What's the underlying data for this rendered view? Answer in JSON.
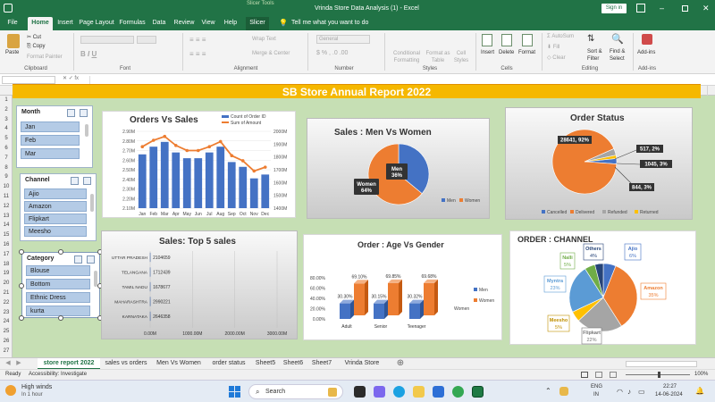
{
  "window": {
    "file_title": "Vrinda Store Data Analysis (1)  -  Excel",
    "tools_label": "Slicer Tools",
    "signin": "Sign in"
  },
  "ribbon_tabs": [
    "File",
    "Home",
    "Insert",
    "Page Layout",
    "Formulas",
    "Data",
    "Review",
    "View",
    "Help",
    "Slicer"
  ],
  "tell_me": "Tell me what you want to do",
  "ribbon": {
    "paste": "Paste",
    "cut": "Cut",
    "copy": "Copy",
    "format_painter": "Format Painter",
    "wrap_text": "Wrap Text",
    "merge_center": "Merge & Center",
    "number_format": "General",
    "conditional": "Conditional Formatting",
    "format_table": "Format as Table",
    "cell_styles": "Cell Styles",
    "insert": "Insert",
    "delete": "Delete",
    "format": "Format",
    "autosum": "AutoSum",
    "fill": "Fill",
    "clear": "Clear",
    "sort_filter": "Sort & Filter",
    "find_select": "Find & Select",
    "addins": "Add-ins",
    "groups": [
      "Clipboard",
      "Font",
      "Alignment",
      "Number",
      "Styles",
      "Cells",
      "Editing",
      "Add-ins"
    ]
  },
  "columns": [
    "A",
    "B",
    "C",
    "D",
    "E",
    "F",
    "G",
    "H",
    "I",
    "J",
    "K",
    "L",
    "M",
    "N",
    "O",
    "P",
    "Q",
    "R",
    "S",
    "T",
    "U",
    "V",
    "W"
  ],
  "rows": [
    "1",
    "2",
    "3",
    "4",
    "5",
    "6",
    "7",
    "8",
    "9",
    "10",
    "11",
    "12",
    "13",
    "14",
    "15",
    "16",
    "17",
    "18",
    "19",
    "20",
    "21",
    "22",
    "23",
    "24",
    "25",
    "26",
    "27"
  ],
  "banner": "SB Store Annual Report 2022",
  "slicers": {
    "month": {
      "title": "Month",
      "items": [
        "Jan",
        "Feb",
        "Mar"
      ]
    },
    "channel": {
      "title": "Channel",
      "items": [
        "Ajio",
        "Amazon",
        "Flipkart",
        "Meesho"
      ]
    },
    "category": {
      "title": "Category",
      "items": [
        "Blouse",
        "Bottom",
        "Ethnic Dress",
        "kurta"
      ]
    }
  },
  "charts": {
    "orders_sales": {
      "title": "Orders Vs Sales",
      "legend_count": "Count of Order ID",
      "legend_sum": "Sum of Amount",
      "left_ticks": [
        "2.90M",
        "2.80M",
        "2.70M",
        "2.60M",
        "2.50M",
        "2.40M",
        "2.30M",
        "2.20M",
        "2.10M"
      ],
      "right_ticks": [
        "2000M",
        "1900M",
        "1800M",
        "1700M",
        "1600M",
        "1500M",
        "1400M"
      ],
      "months": [
        "Jan",
        "Feb",
        "Mar",
        "Apr",
        "May",
        "Jun",
        "Jul",
        "Aug",
        "Sep",
        "Oct",
        "Nov",
        "Dec"
      ]
    },
    "men_women": {
      "title": "Sales : Men Vs Women",
      "men_label": "Men",
      "men_pct": "36%",
      "women_label": "Women",
      "women_pct": "64%",
      "legend_men": "Men",
      "legend_women": "Women"
    },
    "order_status": {
      "title": "Order Status",
      "delivered": "28641, 92%",
      "returned": "517, 2%",
      "refunded": "1045, 3%",
      "cancelled": "844, 3%",
      "legend": [
        "Cancelled",
        "Delivered",
        "Refunded",
        "Returned"
      ]
    },
    "top5": {
      "title": "Sales: Top 5 sales",
      "axis": [
        "0.00M",
        "1000.00M",
        "2000.00M",
        "3000.00M"
      ]
    },
    "age_gender": {
      "title": "Order : Age Vs Gender",
      "y_ticks": [
        "80.00%",
        "60.00%",
        "40.00%",
        "20.00%",
        "0.00%"
      ],
      "labels": {
        "adult_men": "30.30%",
        "adult_women": "69.10%",
        "senior_men": "30.15%",
        "senior_women": "69.85%",
        "teen_men": "30.32%",
        "teen_women": "69.68%"
      },
      "groups": [
        "Adult",
        "Senior",
        "Teenager"
      ],
      "legend_men": "Men",
      "legend_women": "Women",
      "axis_women": "Women"
    },
    "channel": {
      "title": "ORDER : CHANNEL",
      "labels": {
        "ajio": "Ajio",
        "ajio_p": "6%",
        "amazon": "Amazon",
        "amazon_p": "35%",
        "flipkart": "Flipkart",
        "flipkart_p": "22%",
        "meesho": "Meesho",
        "meesho_p": "5%",
        "myntra": "Myntra",
        "myntra_p": "23%",
        "nalli": "Nalli",
        "nalli_p": "5%",
        "others": "Others",
        "others_p": "4%"
      }
    }
  },
  "chart_data": [
    {
      "type": "line",
      "title": "Orders Vs Sales",
      "x": [
        "Jan",
        "Feb",
        "Mar",
        "Apr",
        "May",
        "Jun",
        "Jul",
        "Aug",
        "Sep",
        "Oct",
        "Nov",
        "Dec"
      ],
      "series": [
        {
          "name": "Count of Order ID",
          "values": [
            2.66,
            2.74,
            2.79,
            2.68,
            2.62,
            2.62,
            2.68,
            2.74,
            2.58,
            2.53,
            2.41,
            2.45
          ]
        },
        {
          "name": "Sum of Amount",
          "values": [
            1880,
            1930,
            1960,
            1890,
            1850,
            1850,
            1880,
            1920,
            1810,
            1770,
            1690,
            1720
          ]
        }
      ],
      "ylim": [
        2.1,
        2.9
      ],
      "y2lim": [
        1400,
        2000
      ]
    },
    {
      "type": "pie",
      "title": "Sales : Men Vs Women",
      "categories": [
        "Men",
        "Women"
      ],
      "values": [
        36,
        64
      ]
    },
    {
      "type": "pie",
      "title": "Order Status",
      "categories": [
        "Cancelled",
        "Delivered",
        "Refunded",
        "Returned"
      ],
      "values": [
        844,
        28641,
        1045,
        517
      ]
    },
    {
      "type": "bar",
      "title": "Sales: Top 5 sales",
      "categories": [
        "UTTAR PRADESH",
        "TELANGANA",
        "TAMIL NADU",
        "MAHARASHTRA",
        "KARNATAKA"
      ],
      "values": [
        2104659,
        1712439,
        1678677,
        2990221,
        2646358
      ],
      "xlim": [
        0,
        3000
      ]
    },
    {
      "type": "bar",
      "title": "Order : Age Vs Gender",
      "categories": [
        "Adult",
        "Senior",
        "Teenager"
      ],
      "series": [
        {
          "name": "Men",
          "values": [
            30.3,
            30.15,
            30.32
          ]
        },
        {
          "name": "Women",
          "values": [
            69.1,
            69.85,
            69.68
          ]
        }
      ],
      "ylim": [
        0,
        80
      ]
    },
    {
      "type": "pie",
      "title": "ORDER : CHANNEL",
      "categories": [
        "Ajio",
        "Amazon",
        "Flipkart",
        "Meesho",
        "Myntra",
        "Nalli",
        "Others"
      ],
      "values": [
        6,
        35,
        22,
        5,
        23,
        5,
        4
      ]
    }
  ],
  "sheet_tabs": [
    "store report 2022",
    "sales vs orders",
    "Men Vs Women",
    "order status",
    "Sheet5",
    "Sheet6",
    "Sheet7",
    "Vrinda Store"
  ],
  "status": {
    "ready": "Ready",
    "accessibility": "Accessibility: Investigate",
    "zoom": "100%"
  },
  "taskbar": {
    "weather": "High winds",
    "weather_sub": "In 1 hour",
    "search": "Search",
    "lang1": "ENG",
    "lang2": "IN",
    "time": "22:27",
    "date": "14-06-2024"
  },
  "colors": {
    "excel_green": "#217346",
    "banner": "#f5b800",
    "blue": "#4472c4",
    "orange": "#ed7d31",
    "gray": "#a5a5a5",
    "gold": "#ffc000"
  }
}
